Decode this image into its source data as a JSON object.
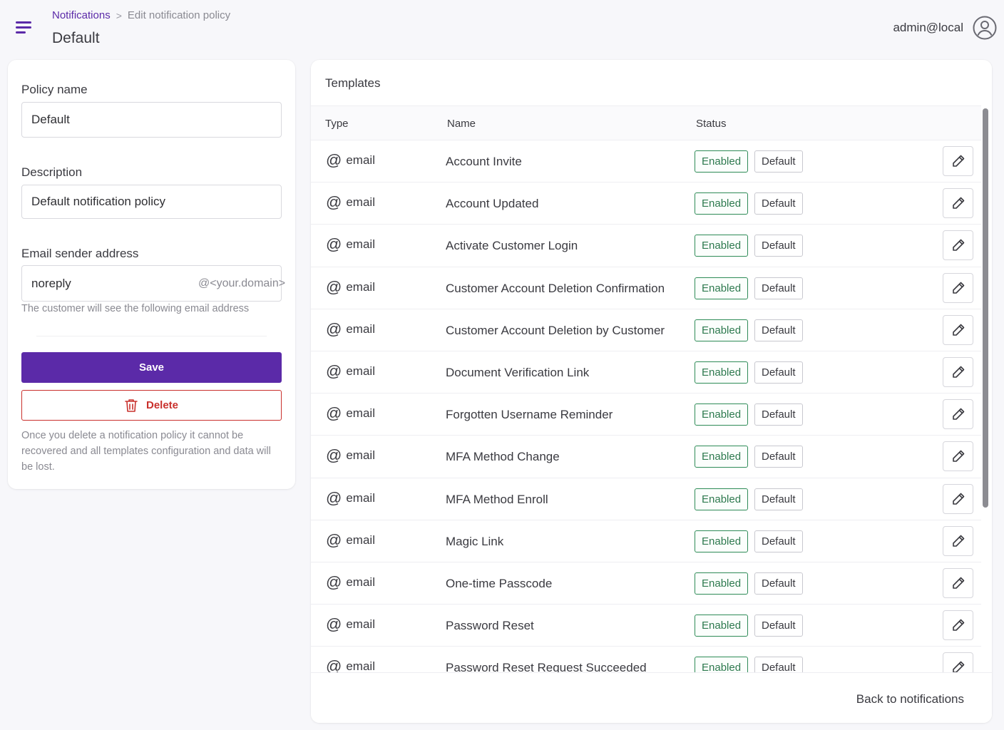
{
  "header": {
    "breadcrumb_parent": "Notifications",
    "breadcrumb_separator": ">",
    "breadcrumb_current": "Edit notification policy",
    "title": "Default",
    "user_name": "admin@local"
  },
  "form": {
    "policy_name_label": "Policy name",
    "policy_name_value": "Default",
    "description_label": "Description",
    "description_value": "Default notification policy",
    "sender_label": "Email sender address",
    "sender_value": "noreply",
    "sender_suffix": "@<your.domain>",
    "sender_help": "The customer will see the following email address",
    "save_label": "Save",
    "delete_label": "Delete",
    "delete_warning": "Once you delete a notification policy it cannot be recovered and all templates configuration and data will be lost."
  },
  "templates": {
    "title": "Templates",
    "columns": {
      "type": "Type",
      "name": "Name",
      "status": "Status"
    },
    "rows": [
      {
        "type": "email",
        "name": "Account Invite",
        "status": "Enabled",
        "source": "Default"
      },
      {
        "type": "email",
        "name": "Account Updated",
        "status": "Enabled",
        "source": "Default"
      },
      {
        "type": "email",
        "name": "Activate Customer Login",
        "status": "Enabled",
        "source": "Default"
      },
      {
        "type": "email",
        "name": "Customer Account Deletion Confirmation",
        "status": "Enabled",
        "source": "Default"
      },
      {
        "type": "email",
        "name": "Customer Account Deletion by Customer",
        "status": "Enabled",
        "source": "Default"
      },
      {
        "type": "email",
        "name": "Document Verification Link",
        "status": "Enabled",
        "source": "Default"
      },
      {
        "type": "email",
        "name": "Forgotten Username Reminder",
        "status": "Enabled",
        "source": "Default"
      },
      {
        "type": "email",
        "name": "MFA Method Change",
        "status": "Enabled",
        "source": "Default"
      },
      {
        "type": "email",
        "name": "MFA Method Enroll",
        "status": "Enabled",
        "source": "Default"
      },
      {
        "type": "email",
        "name": "Magic Link",
        "status": "Enabled",
        "source": "Default"
      },
      {
        "type": "email",
        "name": "One-time Passcode",
        "status": "Enabled",
        "source": "Default"
      },
      {
        "type": "email",
        "name": "Password Reset",
        "status": "Enabled",
        "source": "Default"
      },
      {
        "type": "email",
        "name": "Password Reset Request Succeeded",
        "status": "Enabled",
        "source": "Default"
      }
    ],
    "back_label": "Back to notifications"
  },
  "icons": {
    "menu": "menu-icon",
    "avatar": "user-circle-icon",
    "type": "at-sign-icon",
    "edit": "pencil-icon",
    "delete": "trash-icon"
  },
  "colors": {
    "accent": "#5b2aa8",
    "danger": "#c9302c",
    "enabled": "#2e8b57"
  }
}
